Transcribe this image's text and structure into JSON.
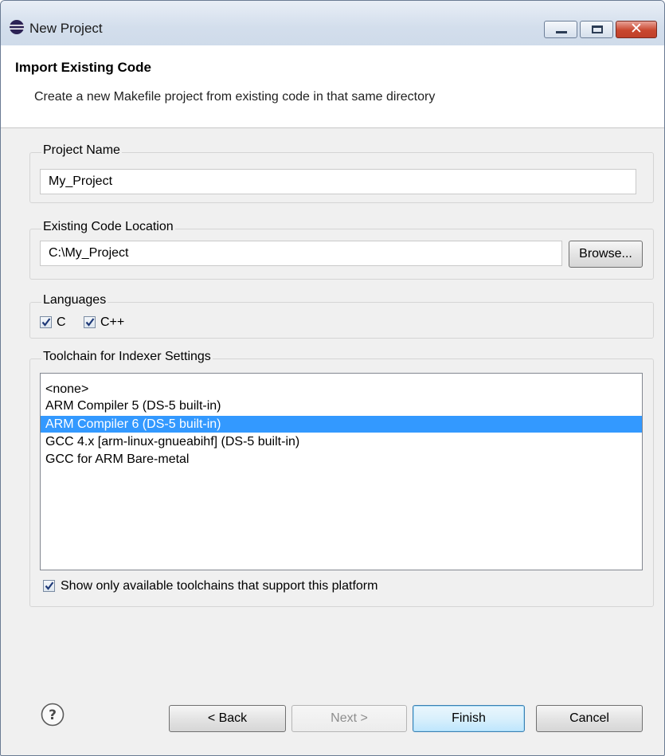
{
  "window": {
    "title": "New Project",
    "icon": "eclipse-icon",
    "controls": [
      "minimize-icon",
      "maximize-icon",
      "close-icon"
    ]
  },
  "header": {
    "title": "Import Existing Code",
    "description": "Create a new Makefile project from existing code in that same directory"
  },
  "project_name": {
    "label": "Project Name",
    "value": "My_Project"
  },
  "code_location": {
    "label": "Existing Code Location",
    "value": "C:\\My_Project",
    "browse_label": "Browse..."
  },
  "languages": {
    "label": "Languages",
    "items": [
      {
        "label": "C",
        "checked": true
      },
      {
        "label": "C++",
        "checked": true
      }
    ]
  },
  "toolchain": {
    "label": "Toolchain for Indexer Settings",
    "items": [
      "<none>",
      "ARM Compiler 5 (DS-5 built-in)",
      "ARM Compiler 6 (DS-5 built-in)",
      "GCC 4.x [arm-linux-gnueabihf] (DS-5 built-in)",
      "GCC for ARM Bare-metal"
    ],
    "selected": "ARM Compiler 6 (DS-5 built-in)",
    "filter_label": "Show only available toolchains that support this platform",
    "filter_checked": true
  },
  "footer": {
    "help_icon": "help-icon",
    "back_label": "< Back",
    "next_label": "Next >",
    "finish_label": "Finish",
    "cancel_label": "Cancel"
  },
  "colors": {
    "selection": "#3399ff",
    "titlebar": "#d3deec",
    "close_button": "#c9472f"
  }
}
